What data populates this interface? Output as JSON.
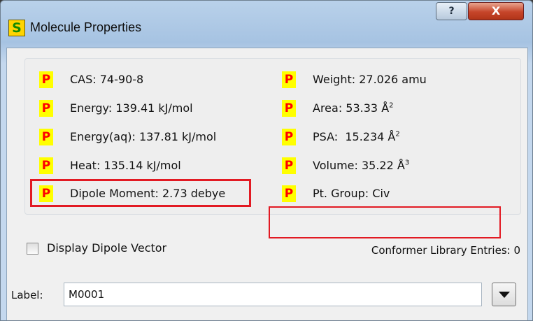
{
  "window": {
    "title": "Molecule Properties",
    "app_icon_letter": "S",
    "help_glyph": "?",
    "close_glyph": "X"
  },
  "properties": {
    "badge": "P",
    "left": [
      {
        "label": "CAS: 74-90-8"
      },
      {
        "label": "Energy: 139.41 kJ/mol"
      },
      {
        "label": "Energy(aq): 137.81 kJ/mol"
      },
      {
        "label": "Heat: 135.14 kJ/mol"
      },
      {
        "label": "Dipole Moment: 2.73 debye"
      }
    ],
    "right": [
      {
        "label": "Weight: 27.026 amu"
      },
      {
        "label": "Area: 53.33 Å",
        "sup": "2"
      },
      {
        "label": "PSA:  15.234 Å",
        "sup": "2"
      },
      {
        "label": "Volume: 35.22 Å",
        "sup": "3"
      },
      {
        "label": "Pt. Group: Civ"
      }
    ]
  },
  "options": {
    "display_dipole_vector_label": "Display Dipole Vector",
    "display_dipole_vector_checked": false,
    "conformer_entries": "Conformer Library Entries: 0"
  },
  "label_field": {
    "caption": "Label:",
    "value": "M0001"
  },
  "colors": {
    "badge_bg": "#ffff00",
    "badge_text": "#ff0000",
    "highlight": "#e21a23"
  }
}
